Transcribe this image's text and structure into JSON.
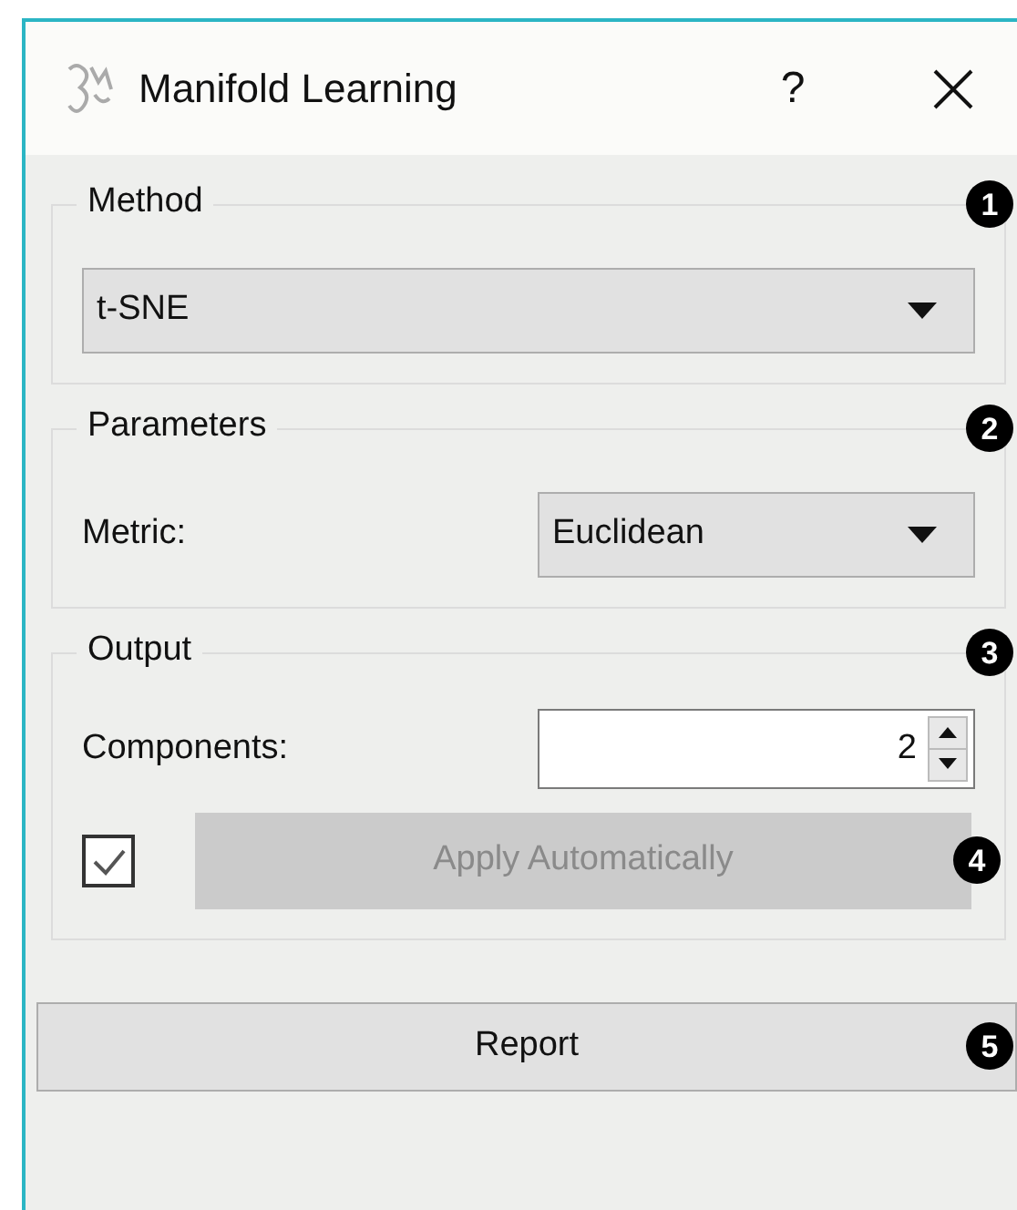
{
  "window": {
    "title": "Manifold Learning",
    "help": "?"
  },
  "groups": [
    {
      "title": "Method",
      "badge": "1",
      "kind": "combo",
      "value": "t-SNE"
    },
    {
      "title": "Parameters",
      "badge": "2",
      "kind": "labeled_combo",
      "label": "Metric:",
      "value": "Euclidean"
    },
    {
      "title": "Output",
      "badge": "3",
      "kind": "output",
      "label": "Components:",
      "value": "2",
      "auto_apply": {
        "checked": true,
        "button": "Apply Automatically",
        "disabled": true,
        "badge": "4"
      }
    }
  ],
  "report": {
    "label": "Report",
    "badge": "5"
  }
}
